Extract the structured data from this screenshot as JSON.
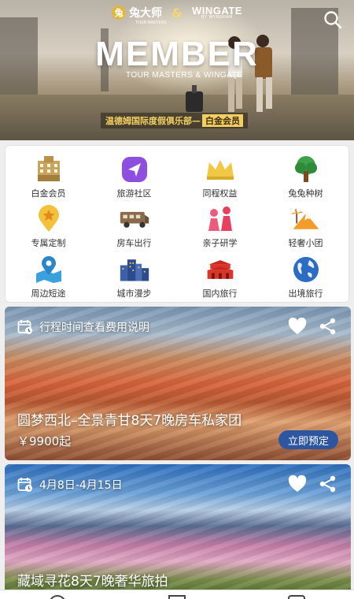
{
  "hero": {
    "brand_left": "兔大师",
    "brand_left_sub": "TOUR MASTERS",
    "brand_amp": "&",
    "brand_right": "WINGATE",
    "brand_right_sub": "BY WYNDHAM",
    "title": "MEMBER",
    "subtitle": "TOUR MASTERS & WINGATE",
    "badge_text": "温德姆国际度假俱乐部—",
    "badge_highlight": "白金会员"
  },
  "categories": [
    {
      "label": "白金会员",
      "icon": "hotel-building-icon"
    },
    {
      "label": "旅游社区",
      "icon": "send-arrow-icon"
    },
    {
      "label": "同程权益",
      "icon": "crown-icon"
    },
    {
      "label": "兔兔种树",
      "icon": "tree-icon"
    },
    {
      "label": "专属定制",
      "icon": "star-pin-icon"
    },
    {
      "label": "房车出行",
      "icon": "rv-icon"
    },
    {
      "label": "亲子研学",
      "icon": "family-icon"
    },
    {
      "label": "轻奢小团",
      "icon": "palm-mountain-icon"
    },
    {
      "label": "周边短途",
      "icon": "map-pin-icon"
    },
    {
      "label": "城市漫步",
      "icon": "city-icon"
    },
    {
      "label": "国内旅行",
      "icon": "gate-tower-icon"
    },
    {
      "label": "出境旅行",
      "icon": "globe-icon"
    }
  ],
  "tours": [
    {
      "date": "行程时间查看费用说明",
      "title": "圆梦西北–全景青甘8天7晚房车私家团",
      "price": "￥9900起",
      "book": "立即预定"
    },
    {
      "date": "4月8日-4月15日",
      "title": "藏域寻花8天7晚奢华旅拍"
    }
  ],
  "colors": {
    "primary_button": "#2e56a0",
    "gold": "#f3cf63"
  }
}
